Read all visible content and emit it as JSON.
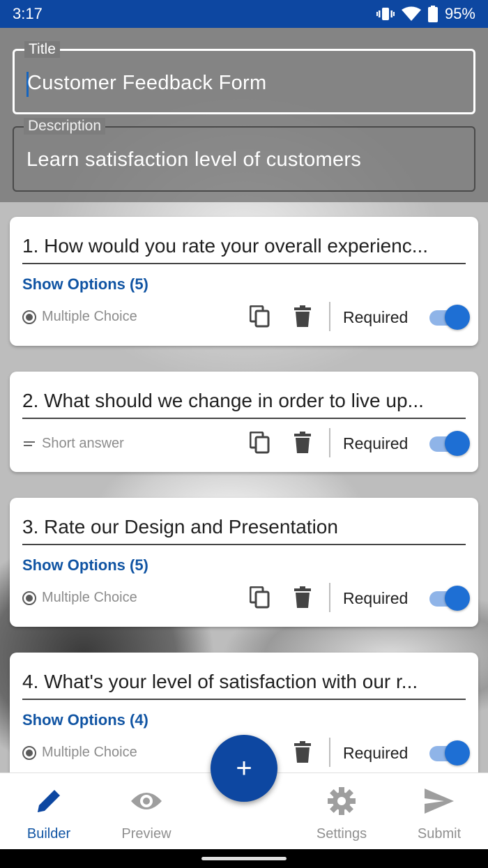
{
  "status_bar": {
    "time": "3:17",
    "battery": "95%"
  },
  "form": {
    "title_label": "Title",
    "title_value": "Customer Feedback Form",
    "description_label": "Description",
    "description_value": "Learn satisfaction level of customers"
  },
  "questions": [
    {
      "text": "1. How would you rate your overall experienc...",
      "show_options": "Show Options (5)",
      "type": "Multiple Choice",
      "required_label": "Required",
      "required": true
    },
    {
      "text": "2. What should we change in order to live up...",
      "show_options": "",
      "type": "Short answer",
      "required_label": "Required",
      "required": true
    },
    {
      "text": "3. Rate our Design and Presentation",
      "show_options": "Show Options (5)",
      "type": "Multiple Choice",
      "required_label": "Required",
      "required": true
    },
    {
      "text": "4. What's your level of satisfaction with our r...",
      "show_options": "Show Options (4)",
      "type": "Multiple Choice",
      "required_label": "Required",
      "required": true
    }
  ],
  "fab": {
    "icon": "plus-icon",
    "label": "+"
  },
  "bottom_nav": [
    {
      "label": "Builder",
      "icon": "pencil-icon",
      "active": true
    },
    {
      "label": "Preview",
      "icon": "eye-icon",
      "active": false
    },
    {
      "label": "Settings",
      "icon": "gear-icon",
      "active": false
    },
    {
      "label": "Submit",
      "icon": "send-icon",
      "active": false
    }
  ],
  "colors": {
    "primary": "#0d47a1",
    "accent": "#1e6fd4",
    "link": "#1054a3"
  }
}
